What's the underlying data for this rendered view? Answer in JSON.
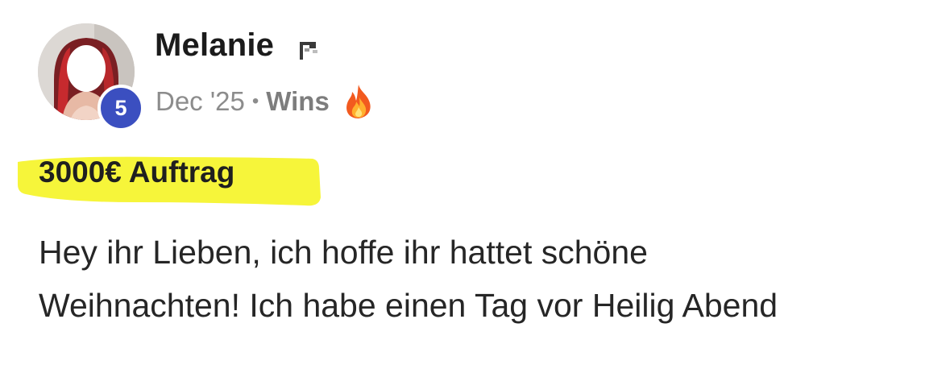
{
  "author": {
    "name": "Melanie",
    "level": "5"
  },
  "meta": {
    "date": "Dec '25",
    "separator": "•",
    "category": "Wins",
    "category_icon": "fire-icon"
  },
  "post": {
    "title": "3000€ Auftrag",
    "body_lines": [
      "Hey ihr Lieben, ich hoffe ihr hattet schöne",
      "Weihnachten! Ich habe einen Tag vor Heilig Abend"
    ]
  },
  "colors": {
    "badge": "#3b4fc0",
    "highlight": "#f6f53a",
    "meta_text": "#8c8c8c"
  }
}
